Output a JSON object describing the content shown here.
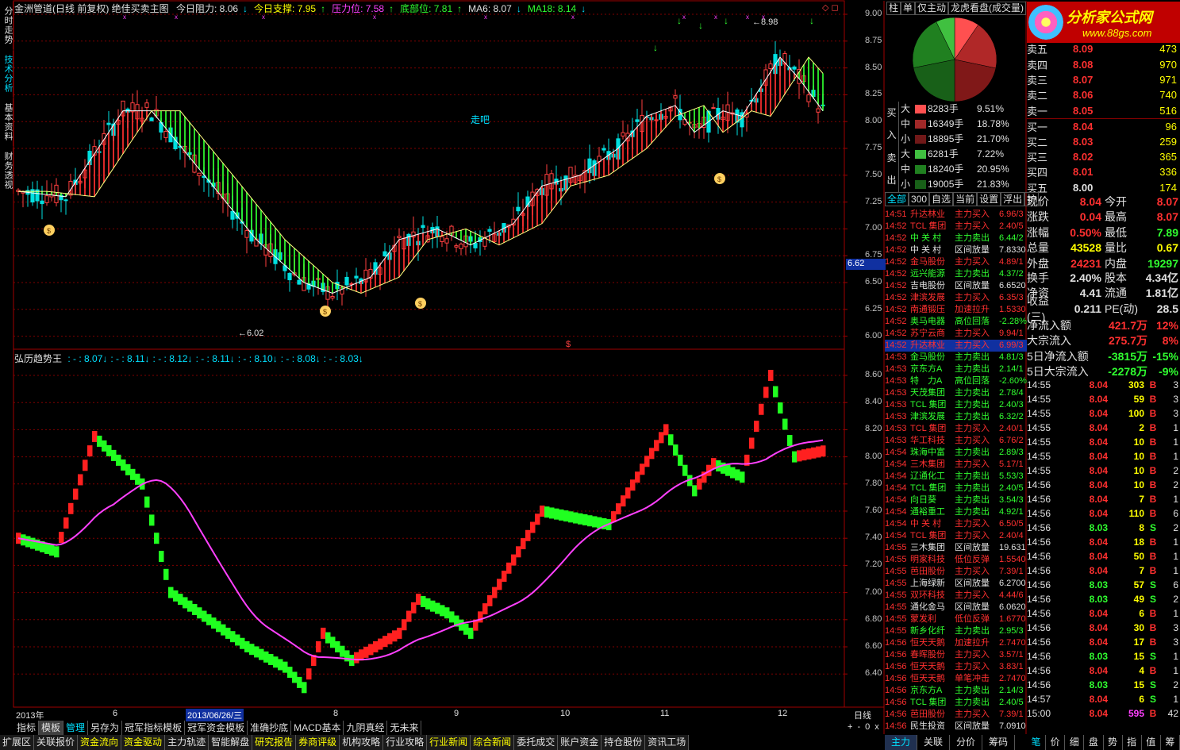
{
  "left_tabs": [
    "分时走势",
    "技术分析",
    "基本资料",
    "财务透视"
  ],
  "main_title": {
    "name": "金洲管道(日线 前复权) 绝佳买卖主图",
    "items": [
      {
        "label": "今日阻力: 8.06",
        "arrow": "↓",
        "color": "#e0e0e0"
      },
      {
        "label": "今日支撑: 7.95",
        "arrow": "↑",
        "color": "#ffff00"
      },
      {
        "label": "压力位: 7.58",
        "arrow": "↑",
        "color": "#ff40ff"
      },
      {
        "label": "底部位: 7.81",
        "arrow": "↑",
        "color": "#30ff30"
      },
      {
        "label": "MA6: 8.07",
        "arrow": "↓",
        "color": "#e0e0e0"
      },
      {
        "label": "MA18: 8.14",
        "arrow": "↓",
        "color": "#30ff30"
      }
    ]
  },
  "main_annotations": {
    "high": "8.98",
    "low": "6.02",
    "zoubar": "走吧",
    "cursor_price": "6.62"
  },
  "sub_title": {
    "name": "弘历趋势王",
    "items": [
      ": - : 8.07↓",
      ": - : 8.11↓",
      ": - : 8.12↓",
      ": - : 8.11↓",
      ": - : 8.10↓",
      ": - : 8.08↓",
      ": - : 8.03↓"
    ]
  },
  "main_axis_ticks": [
    "9.00",
    "8.75",
    "8.50",
    "8.25",
    "8.00",
    "7.75",
    "7.50",
    "7.25",
    "7.00",
    "6.75",
    "6.50",
    "6.25",
    "6.00"
  ],
  "sub_axis_ticks": [
    "8.60",
    "8.40",
    "8.20",
    "8.00",
    "7.80",
    "7.60",
    "7.40",
    "7.20",
    "7.00",
    "6.80",
    "6.60",
    "6.40"
  ],
  "x_labels": [
    "2013年",
    "6",
    "2013/06/26/三",
    "8",
    "9",
    "10",
    "11",
    "12",
    "日线"
  ],
  "toolbar1": [
    "指标",
    "模板",
    "管理",
    "另存为",
    "冠军指标模板",
    "冠军资金模板",
    "准确抄底",
    "MACD基本",
    "九阴真经",
    "无未来"
  ],
  "toolbar2": [
    "扩展区",
    "关联报价",
    "资金流向",
    "资金驱动",
    "主力轨迹",
    "智能解盘",
    "研究报告",
    "券商评级",
    "机构攻略",
    "行业攻略",
    "行业新闻",
    "综合新闻",
    "委托成交",
    "账户资金",
    "持仓股份",
    "资讯工场"
  ],
  "right_tabs": [
    "柱",
    "单",
    "仅主动",
    "龙虎看盘(成交量)"
  ],
  "flow": {
    "buy": [
      {
        "side": "大",
        "qty": "8283手",
        "pct": "9.51%",
        "color": "#ff5050"
      },
      {
        "side": "中",
        "qty": "16349手",
        "pct": "18.78%",
        "color": "#a02828"
      },
      {
        "side": "小",
        "qty": "18895手",
        "pct": "21.70%",
        "color": "#701818"
      }
    ],
    "sell": [
      {
        "side": "大",
        "qty": "6281手",
        "pct": "7.22%",
        "color": "#40c040"
      },
      {
        "side": "中",
        "qty": "18240手",
        "pct": "20.95%",
        "color": "#208020"
      },
      {
        "side": "小",
        "qty": "19005手",
        "pct": "21.83%",
        "color": "#186018"
      }
    ],
    "buy_label": "买入",
    "sell_label": "卖出"
  },
  "pie": [
    {
      "value": 9.51,
      "color": "#ff5050"
    },
    {
      "value": 18.78,
      "color": "#b02828"
    },
    {
      "value": 21.7,
      "color": "#801818"
    },
    {
      "value": 21.83,
      "color": "#186018"
    },
    {
      "value": 20.95,
      "color": "#208020"
    },
    {
      "value": 7.22,
      "color": "#40c040"
    }
  ],
  "logo": {
    "title": "分析家公式网",
    "url": "www.88gs.com"
  },
  "orderbook": [
    {
      "label": "卖五",
      "price": "8.09",
      "vol": "473"
    },
    {
      "label": "卖四",
      "price": "8.08",
      "vol": "970"
    },
    {
      "label": "卖三",
      "price": "8.07",
      "vol": "971"
    },
    {
      "label": "卖二",
      "price": "8.06",
      "vol": "740"
    },
    {
      "label": "卖一",
      "price": "8.05",
      "vol": "516"
    },
    {
      "label": "买一",
      "price": "8.04",
      "vol": "96"
    },
    {
      "label": "买二",
      "price": "8.03",
      "vol": "259"
    },
    {
      "label": "买三",
      "price": "8.02",
      "vol": "365"
    },
    {
      "label": "买四",
      "price": "8.01",
      "vol": "336"
    },
    {
      "label": "买五",
      "price": "8.00",
      "vol": "174"
    }
  ],
  "quote": [
    [
      "现价",
      "8.04",
      "今开",
      "8.07"
    ],
    [
      "涨跌",
      "0.04",
      "最高",
      "8.07"
    ],
    [
      "涨幅",
      "0.50%",
      "最低",
      "7.89"
    ],
    [
      "总量",
      "43528",
      "量比",
      "0.67"
    ],
    [
      "外盘",
      "24231",
      "内盘",
      "19297"
    ]
  ],
  "stats": [
    [
      "换手",
      "2.40%",
      "股本",
      "4.34亿"
    ],
    [
      "净资",
      "4.41",
      "流通",
      "1.81亿"
    ],
    [
      "收益(三)",
      "0.211",
      "PE(动)",
      "28.5"
    ]
  ],
  "flows": [
    [
      "净流入额",
      "421.7万",
      "12%"
    ],
    [
      "大宗流入",
      "275.7万",
      "8%"
    ],
    [
      "5日净流入额",
      "-3815万",
      "-15%"
    ],
    [
      "5日大宗流入",
      "-2278万",
      "-9%"
    ]
  ],
  "list_tabs": [
    "全部",
    "300",
    "自选",
    "当前",
    "设置",
    "浮出",
    "护"
  ],
  "news": [
    [
      "14:51",
      "升达林业",
      "主力买入",
      "6.96/3"
    ],
    [
      "14:52",
      "TCL 集团",
      "主力买入",
      "2.40/5"
    ],
    [
      "14:52",
      "中 关 村",
      "主力卖出",
      "6.44/2"
    ],
    [
      "14:52",
      "中 关 村",
      "区间放量",
      "7.8330"
    ],
    [
      "14:52",
      "金马股份",
      "主力买入",
      "4.89/1"
    ],
    [
      "14:52",
      "远兴能源",
      "主力卖出",
      "4.37/2"
    ],
    [
      "14:52",
      "吉电股份",
      "区间放量",
      "6.6520"
    ],
    [
      "14:52",
      "津滨发展",
      "主力买入",
      "6.35/3"
    ],
    [
      "14:52",
      "南通锻压",
      "加速拉升",
      "1.5330"
    ],
    [
      "14:52",
      "奥马电器",
      "高位回落",
      "-2.28%"
    ],
    [
      "14:52",
      "苏宁云商",
      "主力买入",
      "9.94/1"
    ],
    [
      "14:52",
      "升达林业",
      "主力买入",
      "6.99/3"
    ],
    [
      "14:53",
      "金马股份",
      "主力卖出",
      "4.81/3"
    ],
    [
      "14:53",
      "京东方A",
      "主力卖出",
      "2.14/1"
    ],
    [
      "14:53",
      "特　力A",
      "高位回落",
      "-2.60%"
    ],
    [
      "14:53",
      "天茂集团",
      "主力卖出",
      "2.78/4"
    ],
    [
      "14:53",
      "TCL 集团",
      "主力卖出",
      "2.40/3"
    ],
    [
      "14:53",
      "津滨发展",
      "主力卖出",
      "6.32/2"
    ],
    [
      "14:53",
      "TCL 集团",
      "主力买入",
      "2.40/1"
    ],
    [
      "14:53",
      "华工科技",
      "主力买入",
      "6.76/2"
    ],
    [
      "14:54",
      "珠海中富",
      "主力卖出",
      "2.89/3"
    ],
    [
      "14:54",
      "三木集团",
      "主力买入",
      "5.17/1"
    ],
    [
      "14:54",
      "辽通化工",
      "主力卖出",
      "5.53/3"
    ],
    [
      "14:54",
      "TCL 集团",
      "主力卖出",
      "2.40/5"
    ],
    [
      "14:54",
      "向日葵",
      "主力卖出",
      "3.54/3"
    ],
    [
      "14:54",
      "通裕重工",
      "主力卖出",
      "4.92/1"
    ],
    [
      "14:54",
      "中 关 村",
      "主力买入",
      "6.50/5"
    ],
    [
      "14:54",
      "TCL 集团",
      "主力买入",
      "2.40/4"
    ],
    [
      "14:55",
      "三木集团",
      "区间放量",
      "19.631"
    ],
    [
      "14:55",
      "明家科技",
      "低位反弹",
      "1.5540"
    ],
    [
      "14:55",
      "芭田股份",
      "主力买入",
      "7.39/1"
    ],
    [
      "14:55",
      "上海绿新",
      "区间放量",
      "6.2700"
    ],
    [
      "14:55",
      "双环科技",
      "主力买入",
      "4.44/6"
    ],
    [
      "14:55",
      "通化金马",
      "区间放量",
      "6.0620"
    ],
    [
      "14:55",
      "蒙发利",
      "低位反弹",
      "1.6770"
    ],
    [
      "14:55",
      "新乡化纤",
      "主力卖出",
      "2.95/3"
    ],
    [
      "14:56",
      "恒天天鹅",
      "加速拉升",
      "2.7470"
    ],
    [
      "14:56",
      "春晖股份",
      "主力买入",
      "3.57/1"
    ],
    [
      "14:56",
      "恒天天鹅",
      "主力买入",
      "3.83/1"
    ],
    [
      "14:56",
      "恒天天鹅",
      "单笔冲击",
      "2.7470"
    ],
    [
      "14:56",
      "京东方A",
      "主力卖出",
      "2.14/3"
    ],
    [
      "14:56",
      "TCL 集团",
      "主力卖出",
      "2.40/5"
    ],
    [
      "14:56",
      "芭田股份",
      "主力买入",
      "7.39/1"
    ],
    [
      "14:56",
      "民生投资",
      "区间放量",
      "7.0910"
    ]
  ],
  "ticks": [
    [
      "14:55",
      "8.04",
      "303",
      "B",
      "3"
    ],
    [
      "14:55",
      "8.04",
      "59",
      "B",
      "3"
    ],
    [
      "14:55",
      "8.04",
      "100",
      "B",
      "3"
    ],
    [
      "14:55",
      "8.04",
      "2",
      "B",
      "1"
    ],
    [
      "14:55",
      "8.04",
      "10",
      "B",
      "1"
    ],
    [
      "14:55",
      "8.04",
      "10",
      "B",
      "1"
    ],
    [
      "14:55",
      "8.04",
      "10",
      "B",
      "2"
    ],
    [
      "14:56",
      "8.04",
      "10",
      "B",
      "2"
    ],
    [
      "14:56",
      "8.04",
      "7",
      "B",
      "1"
    ],
    [
      "14:56",
      "8.04",
      "110",
      "B",
      "6"
    ],
    [
      "14:56",
      "8.03",
      "8",
      "S",
      "2"
    ],
    [
      "14:56",
      "8.04",
      "18",
      "B",
      "1"
    ],
    [
      "14:56",
      "8.04",
      "50",
      "B",
      "1"
    ],
    [
      "14:56",
      "8.04",
      "7",
      "B",
      "1"
    ],
    [
      "14:56",
      "8.03",
      "57",
      "S",
      "6"
    ],
    [
      "14:56",
      "8.03",
      "49",
      "S",
      "2"
    ],
    [
      "14:56",
      "8.04",
      "6",
      "B",
      "1"
    ],
    [
      "14:56",
      "8.04",
      "30",
      "B",
      "3"
    ],
    [
      "14:56",
      "8.04",
      "17",
      "B",
      "3"
    ],
    [
      "14:56",
      "8.03",
      "15",
      "S",
      "1"
    ],
    [
      "14:56",
      "8.04",
      "4",
      "B",
      "1"
    ],
    [
      "14:56",
      "8.03",
      "15",
      "S",
      "2"
    ],
    [
      "14:57",
      "8.04",
      "6",
      "S",
      "1"
    ],
    [
      "15:00",
      "8.04",
      "595",
      "B",
      "42"
    ]
  ],
  "bottom_tabs": [
    "主力",
    "关联",
    "分价",
    "筹码"
  ],
  "bottom_icons": [
    "笔",
    "价",
    "细",
    "盘",
    "势",
    "指",
    "值",
    "筹"
  ],
  "pager": [
    "+",
    "-",
    "0",
    "x"
  ]
}
